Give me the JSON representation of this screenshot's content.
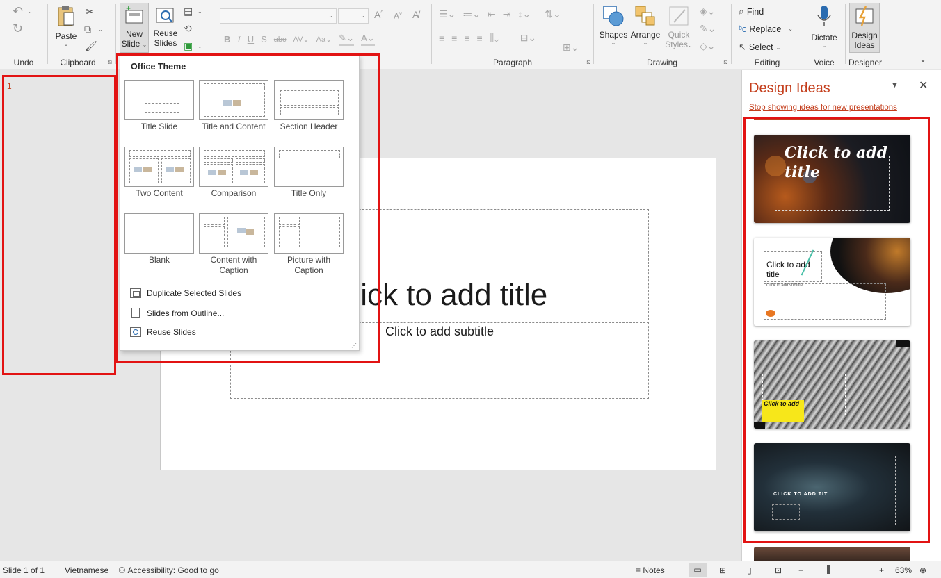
{
  "ribbon": {
    "groups": {
      "undo": "Undo",
      "clipboard": "Clipboard",
      "paragraph": "Paragraph",
      "drawing": "Drawing",
      "editing": "Editing",
      "voice": "Voice",
      "designer": "Designer"
    },
    "buttons": {
      "paste": "Paste",
      "new_slide_1": "New",
      "new_slide_2": "Slide",
      "reuse_1": "Reuse",
      "reuse_2": "Slides",
      "shapes": "Shapes",
      "arrange": "Arrange",
      "quick_styles_1": "Quick",
      "quick_styles_2": "Styles",
      "find": "Find",
      "replace": "Replace",
      "select": "Select",
      "dictate": "Dictate",
      "design_ideas_1": "Design",
      "design_ideas_2": "Ideas"
    },
    "font_format": {
      "bold": "B",
      "italic": "I",
      "underline": "U",
      "strike": "S",
      "shadow": "abc"
    }
  },
  "thumbnails": {
    "slide_number": "1"
  },
  "slide": {
    "title": "Click to add title",
    "subtitle": "Click to add subtitle"
  },
  "new_slide_menu": {
    "header": "Office Theme",
    "layouts": [
      {
        "label": "Title Slide"
      },
      {
        "label": "Title and Content"
      },
      {
        "label": "Section Header"
      },
      {
        "label": "Two Content"
      },
      {
        "label": "Comparison"
      },
      {
        "label": "Title Only"
      },
      {
        "label": "Blank"
      },
      {
        "label": "Content with Caption"
      },
      {
        "label": "Picture with Caption"
      }
    ],
    "actions": {
      "duplicate": "Duplicate Selected Slides",
      "outline": "Slides from Outline...",
      "reuse": "Reuse Slides"
    }
  },
  "design_ideas": {
    "title": "Design Ideas",
    "stop_link": "Stop showing ideas for new presentations",
    "card1_title": "Click to add title",
    "card2_title": "Click to add title",
    "card2_sub": "Click to add subtitle",
    "card3_title": "Click to add",
    "card4_title": "CLICK TO ADD TIT"
  },
  "status_bar": {
    "slide_info": "Slide 1 of 1",
    "language": "Vietnamese",
    "accessibility": "Accessibility: Good to go",
    "notes": "Notes",
    "zoom": "63%"
  },
  "colors": {
    "accent": "#c43e1c",
    "highlight": "#e21313"
  }
}
